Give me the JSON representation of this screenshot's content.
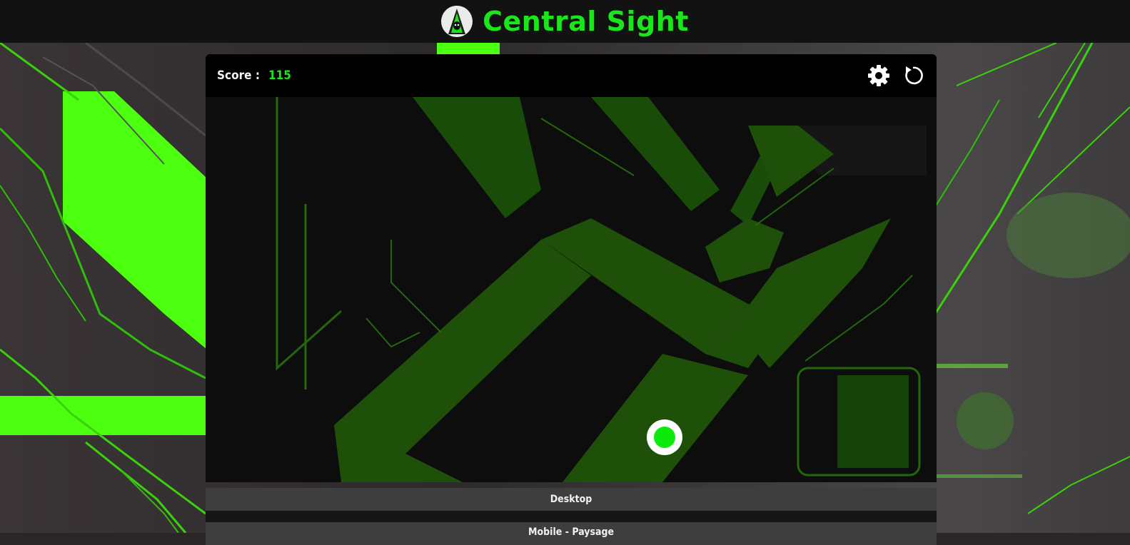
{
  "header": {
    "logo_icon": "alien-mask-logo-icon",
    "title": "Central Sight"
  },
  "game": {
    "score_label": "Score :",
    "score_value": "115",
    "settings_icon": "gear-icon",
    "restart_icon": "restart-icon",
    "target_icon": "green-dot-target-icon"
  },
  "modes": {
    "desktop_label": "Desktop",
    "mobile_label": "Mobile - Paysage"
  },
  "colors": {
    "accent": "#1be51b",
    "header_bg": "#121212",
    "topbar_bg": "#000000",
    "button_bg": "#3e3e3e",
    "target_outer": "#ffffff",
    "target_inner": "#0bea0b"
  }
}
